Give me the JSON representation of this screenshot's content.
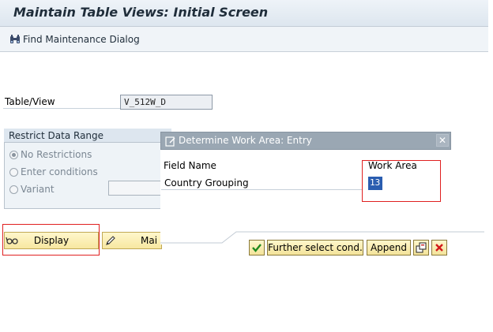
{
  "screen": {
    "title": "Maintain Table Views: Initial Screen",
    "toolbar": {
      "find_label": "Find Maintenance Dialog"
    }
  },
  "table_view": {
    "label": "Table/View",
    "value": "V_512W_D"
  },
  "restrict": {
    "header": "Restrict Data Range",
    "options": [
      {
        "label": "No Restrictions",
        "selected": true
      },
      {
        "label": "Enter conditions",
        "selected": false
      },
      {
        "label": "Variant",
        "selected": false
      }
    ]
  },
  "actions": {
    "display_label": "Display",
    "maintain_label": "Mai"
  },
  "dialog": {
    "title": "Determine Work Area: Entry",
    "col_field_name": "Field Name",
    "col_work_area": "Work Area",
    "row_field": "Country Grouping",
    "row_value": "13",
    "buttons": {
      "further": "Further select cond.",
      "append": "Append"
    }
  },
  "icons": {
    "find": "binoculars-icon",
    "display": "glasses-icon",
    "maintain": "pencil-icon",
    "dialog": "entry-icon",
    "close": "close-icon",
    "ok": "checkmark-icon",
    "multi": "multiple-selection-icon",
    "cancel": "cancel-icon"
  },
  "colors": {
    "highlight": "#e02020",
    "selection": "#2a5db0",
    "button_yellow": "#f7e7a0",
    "dialog_title": "#9aa7b3"
  }
}
